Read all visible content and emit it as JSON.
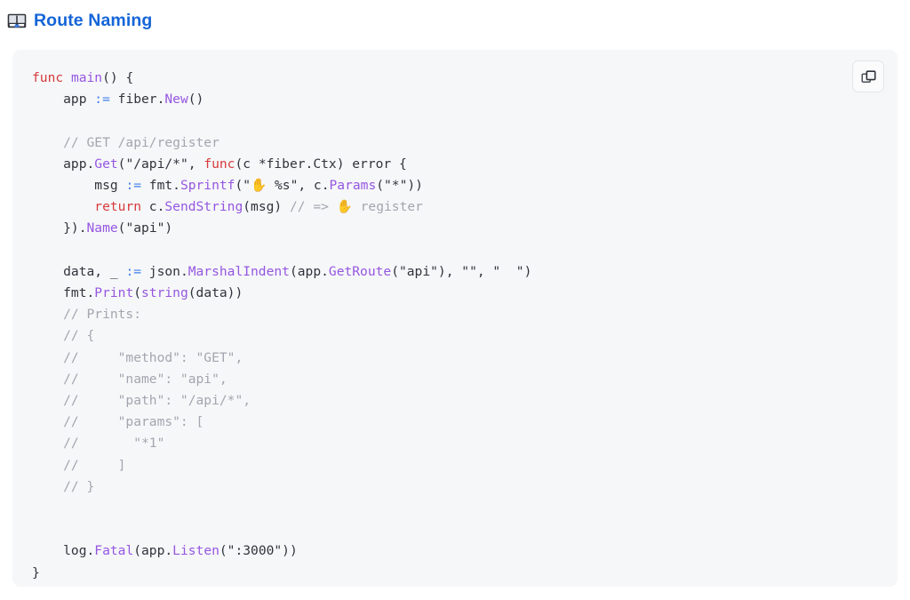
{
  "heading": {
    "icon": "open-book-icon",
    "icon_glyph": "📖",
    "title": "Route Naming",
    "color": "#1565d8"
  },
  "code_block": {
    "language": "go",
    "background": "#f6f7f9",
    "copy_button": {
      "icon": "copy-icon",
      "label": "",
      "title": "Copy"
    },
    "colors": {
      "keyword": "#d63a3a",
      "function": "#9557e0",
      "operator": "#3d7dea",
      "comment": "#a2a6ae",
      "plain": "#2f343b"
    },
    "lines": [
      [
        {
          "t": "func",
          "c": "kw"
        },
        {
          "t": " ",
          "c": "pl"
        },
        {
          "t": "main",
          "c": "fn"
        },
        {
          "t": "() {",
          "c": "pl"
        }
      ],
      [
        {
          "t": "    app ",
          "c": "pl"
        },
        {
          "t": ":=",
          "c": "op"
        },
        {
          "t": " fiber.",
          "c": "pl"
        },
        {
          "t": "New",
          "c": "fn"
        },
        {
          "t": "()",
          "c": "pl"
        }
      ],
      [],
      [
        {
          "t": "    // GET /api/register",
          "c": "cm"
        }
      ],
      [
        {
          "t": "    app.",
          "c": "pl"
        },
        {
          "t": "Get",
          "c": "fn"
        },
        {
          "t": "(\"/api/*\", ",
          "c": "pl"
        },
        {
          "t": "func",
          "c": "kw"
        },
        {
          "t": "(c *fiber.Ctx) error {",
          "c": "pl"
        }
      ],
      [
        {
          "t": "        msg ",
          "c": "pl"
        },
        {
          "t": ":=",
          "c": "op"
        },
        {
          "t": " fmt.",
          "c": "pl"
        },
        {
          "t": "Sprintf",
          "c": "fn"
        },
        {
          "t": "(\"",
          "c": "pl"
        },
        {
          "t": "✋",
          "c": "em"
        },
        {
          "t": " %s\", c.",
          "c": "pl"
        },
        {
          "t": "Params",
          "c": "fn"
        },
        {
          "t": "(\"*\"))",
          "c": "pl"
        }
      ],
      [
        {
          "t": "        ",
          "c": "pl"
        },
        {
          "t": "return",
          "c": "kw"
        },
        {
          "t": " c.",
          "c": "pl"
        },
        {
          "t": "SendString",
          "c": "fn"
        },
        {
          "t": "(msg) ",
          "c": "pl"
        },
        {
          "t": "// => ",
          "c": "cm"
        },
        {
          "t": "✋",
          "c": "em"
        },
        {
          "t": " register",
          "c": "cm"
        }
      ],
      [
        {
          "t": "    }).",
          "c": "pl"
        },
        {
          "t": "Name",
          "c": "fn"
        },
        {
          "t": "(\"api\")",
          "c": "pl"
        }
      ],
      [],
      [
        {
          "t": "    data, _ ",
          "c": "pl"
        },
        {
          "t": ":=",
          "c": "op"
        },
        {
          "t": " json.",
          "c": "pl"
        },
        {
          "t": "MarshalIndent",
          "c": "fn"
        },
        {
          "t": "(app.",
          "c": "pl"
        },
        {
          "t": "GetRoute",
          "c": "fn"
        },
        {
          "t": "(\"api\"), \"\", \"  \")",
          "c": "pl"
        }
      ],
      [
        {
          "t": "    fmt.",
          "c": "pl"
        },
        {
          "t": "Print",
          "c": "fn"
        },
        {
          "t": "(",
          "c": "pl"
        },
        {
          "t": "string",
          "c": "fn"
        },
        {
          "t": "(data))",
          "c": "pl"
        }
      ],
      [
        {
          "t": "    // Prints:",
          "c": "cm"
        }
      ],
      [
        {
          "t": "    // {",
          "c": "cm"
        }
      ],
      [
        {
          "t": "    //     \"method\": \"GET\",",
          "c": "cm"
        }
      ],
      [
        {
          "t": "    //     \"name\": \"api\",",
          "c": "cm"
        }
      ],
      [
        {
          "t": "    //     \"path\": \"/api/*\",",
          "c": "cm"
        }
      ],
      [
        {
          "t": "    //     \"params\": [",
          "c": "cm"
        }
      ],
      [
        {
          "t": "    //       \"*1\"",
          "c": "cm"
        }
      ],
      [
        {
          "t": "    //     ]",
          "c": "cm"
        }
      ],
      [
        {
          "t": "    // }",
          "c": "cm"
        }
      ],
      [],
      [],
      [
        {
          "t": "    log.",
          "c": "pl"
        },
        {
          "t": "Fatal",
          "c": "fn"
        },
        {
          "t": "(app.",
          "c": "pl"
        },
        {
          "t": "Listen",
          "c": "fn"
        },
        {
          "t": "(\":3000\"))",
          "c": "pl"
        }
      ],
      [
        {
          "t": "}",
          "c": "pl"
        }
      ]
    ]
  }
}
